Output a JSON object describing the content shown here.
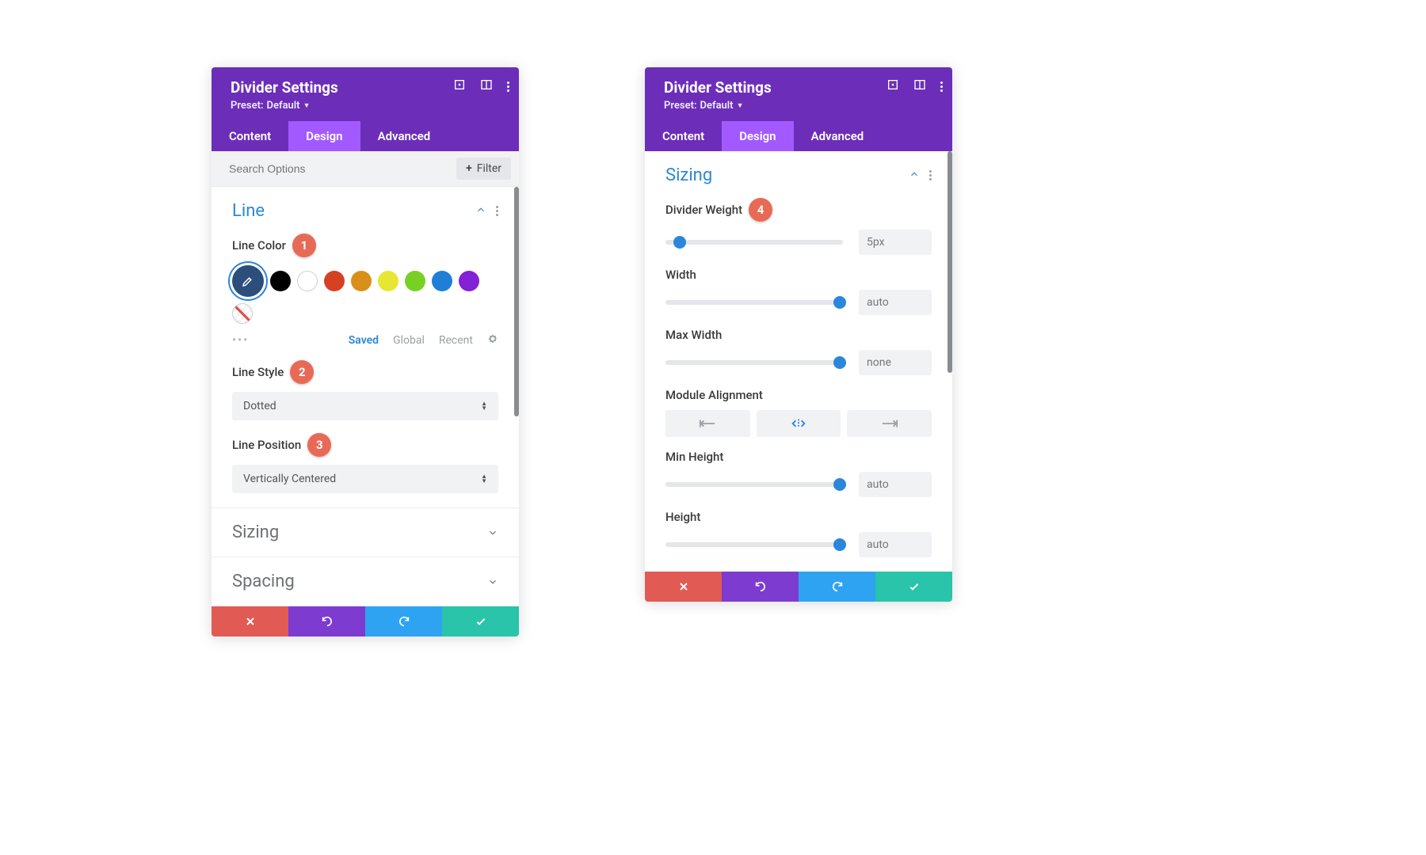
{
  "header": {
    "title": "Divider Settings",
    "preset_prefix": "Preset:",
    "preset_value": "Default"
  },
  "tabs": {
    "content": "Content",
    "design": "Design",
    "advanced": "Advanced"
  },
  "search": {
    "placeholder": "Search Options",
    "filter_label": "Filter"
  },
  "line_section": {
    "title": "Line",
    "color_label": "Line Color",
    "palette_saved": "Saved",
    "palette_global": "Global",
    "palette_recent": "Recent",
    "style_label": "Line Style",
    "style_value": "Dotted",
    "position_label": "Line Position",
    "position_value": "Vertically Centered",
    "swatch_colors": [
      "#000000",
      "#ffffff",
      "#d64123",
      "#d8901b",
      "#e7e733",
      "#78d024",
      "#1f7fd6",
      "#8221d6"
    ]
  },
  "collapsed": {
    "sizing": "Sizing",
    "spacing": "Spacing"
  },
  "sizing_section": {
    "title": "Sizing",
    "divider_weight_label": "Divider Weight",
    "divider_weight_value": "5px",
    "width_label": "Width",
    "width_value": "auto",
    "max_width_label": "Max Width",
    "max_width_value": "none",
    "alignment_label": "Module Alignment",
    "min_height_label": "Min Height",
    "min_height_value": "auto",
    "height_label": "Height",
    "height_value": "auto"
  },
  "badges": {
    "b1": "1",
    "b2": "2",
    "b3": "3",
    "b4": "4"
  }
}
